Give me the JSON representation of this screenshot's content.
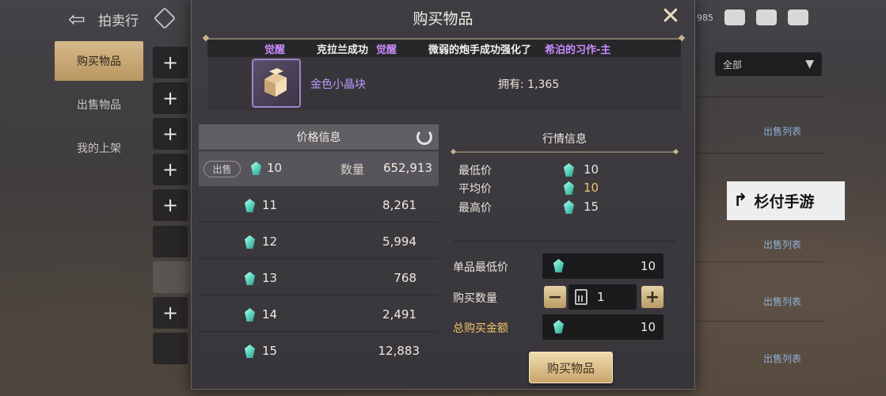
{
  "background": {
    "title": "拍卖行",
    "side_tabs": [
      "购买物品",
      "出售物品",
      "我的上架"
    ],
    "plus_labels": [
      "+",
      "+",
      "+",
      "+",
      "+",
      "+"
    ],
    "top_mini": "985",
    "dropdown": {
      "value": "全部"
    },
    "sell_list_label": "出售列表"
  },
  "watermark": {
    "text": "杉付手游"
  },
  "modal": {
    "title": "购买物品",
    "ticker": [
      {
        "text": "觉醒",
        "color": "purple"
      },
      {
        "text": "克拉兰成功",
        "color": "white"
      },
      {
        "text": "觉醒",
        "color": "purple"
      },
      {
        "text": "微弱的炮手成功强化了",
        "color": "white"
      },
      {
        "text": "希泊的习作-主",
        "color": "purple"
      }
    ],
    "item": {
      "name": "金色小晶块",
      "owned_label": "拥有: 1,365"
    },
    "price_panel": {
      "title": "价格信息",
      "sell_badge": "出售",
      "qty_label": "数量",
      "rows": [
        {
          "price": "10",
          "qty": "652,913"
        },
        {
          "price": "11",
          "qty": "8,261"
        },
        {
          "price": "12",
          "qty": "5,994"
        },
        {
          "price": "13",
          "qty": "768"
        },
        {
          "price": "14",
          "qty": "2,491"
        },
        {
          "price": "15",
          "qty": "12,883"
        }
      ]
    },
    "market_panel": {
      "title": "行情信息",
      "min_label": "最低价",
      "min_value": "10",
      "avg_label": "平均价",
      "avg_value": "10",
      "max_label": "最高价",
      "max_value": "15"
    },
    "form": {
      "unit_min_label": "单品最低价",
      "unit_min_value": "10",
      "qty_label": "购买数量",
      "qty_value": "1",
      "total_label": "总购买金额",
      "total_value": "10",
      "minus": "−",
      "plus": "+"
    },
    "buy_button": "购买物品"
  },
  "colors": {
    "accent_gold": "#f2c46b",
    "item_purple": "#b79cff",
    "ticker_purple": "#c98cff"
  }
}
